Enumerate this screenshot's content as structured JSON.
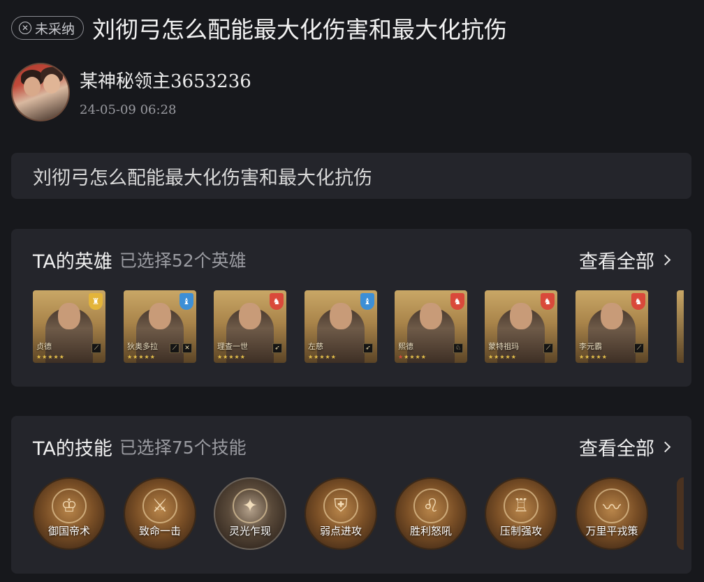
{
  "header": {
    "status_label": "未采纳",
    "status_icon": "close-circle-icon",
    "title": "刘彻弓怎么配能最大化伤害和最大化抗伤"
  },
  "author": {
    "name": "某神秘领主3653236",
    "time": "24-05-09 06:28"
  },
  "question": {
    "text": "刘彻弓怎么配能最大化伤害和最大化抗伤"
  },
  "heroes_section": {
    "title": "TA的英雄",
    "subtitle": "已选择52个英雄",
    "view_all": "查看全部",
    "items": [
      {
        "name": "贞德",
        "crest": "yellow"
      },
      {
        "name": "狄奥多拉",
        "crest": "blue"
      },
      {
        "name": "理查一世",
        "crest": "red"
      },
      {
        "name": "左慈",
        "crest": "blue"
      },
      {
        "name": "熙德",
        "crest": "red"
      },
      {
        "name": "蒙特祖玛",
        "crest": "red"
      },
      {
        "name": "李元霸",
        "crest": "red"
      }
    ]
  },
  "skills_section": {
    "title": "TA的技能",
    "subtitle": "已选择75个技能",
    "view_all": "查看全部",
    "items": [
      {
        "name": "御国帝术"
      },
      {
        "name": "致命一击"
      },
      {
        "name": "灵光乍现"
      },
      {
        "name": "弱点进攻"
      },
      {
        "name": "胜利怒吼"
      },
      {
        "name": "压制强攻"
      },
      {
        "name": "万里平戎策"
      }
    ]
  },
  "colors": {
    "background": "#17181c",
    "card": "#24252b",
    "gold": "#e7c14a",
    "crest_red": "#d9493a",
    "crest_blue": "#3d8fd6",
    "crest_yellow": "#e3b43a"
  }
}
